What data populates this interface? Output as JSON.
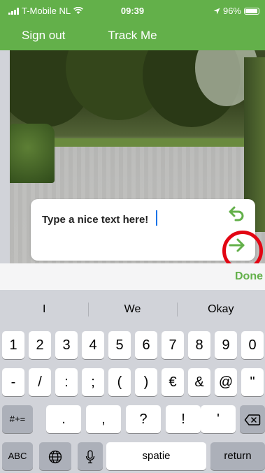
{
  "status_bar": {
    "carrier": "T-Mobile NL",
    "time": "09:39",
    "battery": "96%"
  },
  "nav": {
    "left_button": "Sign out",
    "title": "Track Me"
  },
  "text_card": {
    "placeholder": "Type a nice text here!",
    "value": "Type a nice text here!"
  },
  "toolbar": {
    "done_label": "Done"
  },
  "keyboard": {
    "suggestions": [
      "I",
      "We",
      "Okay"
    ],
    "row1": [
      "1",
      "2",
      "3",
      "4",
      "5",
      "6",
      "7",
      "8",
      "9",
      "0"
    ],
    "row2": [
      "-",
      "/",
      ":",
      ";",
      "(",
      ")",
      "€",
      "&",
      "@",
      "\""
    ],
    "row3": {
      "toggle": "#+=",
      "keys": [
        ".",
        ",",
        "?",
        "!",
        "'"
      ]
    },
    "row4": {
      "abc": "ABC",
      "space": "spatie",
      "return": "return"
    }
  },
  "colors": {
    "brand_green": "#63b04a",
    "highlight_red": "#e20613"
  }
}
